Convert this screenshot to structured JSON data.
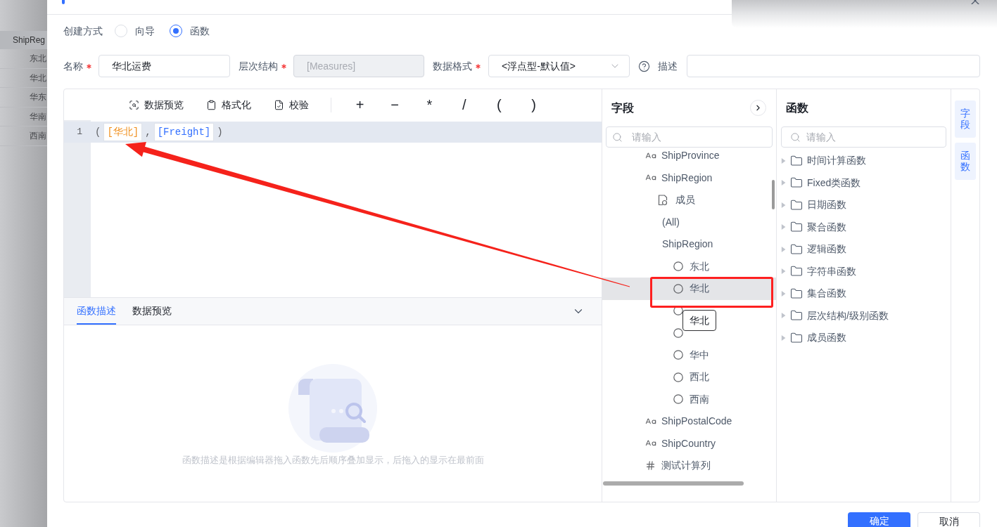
{
  "backdrop_table": {
    "header": "ShipReg",
    "rows": [
      "东北",
      "华北",
      "华东",
      "华南",
      "西南"
    ]
  },
  "creation_mode": {
    "label": "创建方式",
    "options": [
      {
        "label": "向导",
        "selected": false
      },
      {
        "label": "函数",
        "selected": true
      }
    ]
  },
  "form_fields": [
    {
      "kind": "input",
      "label": "名称",
      "required": true,
      "value": "华北运费",
      "disabled": false
    },
    {
      "kind": "input",
      "label": "层次结构",
      "required": true,
      "value": "[Measures]",
      "disabled": true
    },
    {
      "kind": "select",
      "label": "数据格式",
      "required": true,
      "value": "<浮点型-默认值>",
      "disabled": false
    },
    {
      "kind": "help_input",
      "label": "描述",
      "required": false,
      "disabled": false
    }
  ],
  "editor": {
    "toolbar": [
      {
        "kind": "preview",
        "label": "数据预览"
      },
      {
        "kind": "format",
        "label": "格式化"
      },
      {
        "kind": "validate",
        "label": "校验"
      }
    ],
    "operators": [
      "+",
      "−",
      "*",
      "/",
      "(",
      ")"
    ],
    "lines": [
      {
        "number": "1",
        "active": true,
        "tokens": [
          {
            "kind": "punct",
            "text": "("
          },
          {
            "kind": "member",
            "text": "[华北]"
          },
          {
            "kind": "punct",
            "text": ","
          },
          {
            "kind": "measure",
            "text": "[Freight]"
          },
          {
            "kind": "punct",
            "text": ")"
          }
        ]
      }
    ]
  },
  "bottom_panel": {
    "tabs": [
      {
        "label": "函数描述",
        "selected": true
      },
      {
        "label": "数据预览",
        "selected": false
      }
    ],
    "empty_text": "函数描述是根据编辑器拖入函数先后顺序叠加显示，后拖入的显示在最前面"
  },
  "fields_panel": {
    "title": "字段",
    "search_placeholder": "请输入",
    "tree": [
      {
        "kind": "text",
        "label": "ShipProvince"
      },
      {
        "kind": "text",
        "label": "ShipRegion",
        "children": [
          {
            "kind": "group",
            "label": "成员",
            "children": [
              {
                "kind": "level",
                "label": "(All)"
              },
              {
                "kind": "level",
                "label": "ShipRegion",
                "children": [
                  {
                    "kind": "member",
                    "label": "东北",
                    "hovered": false
                  },
                  {
                    "kind": "member",
                    "label": "华北",
                    "hovered": true
                  },
                  {
                    "kind": "member",
                    "hovered": false
                  },
                  {
                    "kind": "member",
                    "hovered": false
                  },
                  {
                    "kind": "member",
                    "label": "华中",
                    "hovered": false
                  },
                  {
                    "kind": "member",
                    "label": "西北",
                    "hovered": false
                  },
                  {
                    "kind": "member",
                    "label": "西南",
                    "hovered": false
                  }
                ]
              }
            ]
          }
        ]
      },
      {
        "kind": "text",
        "label": "ShipPostalCode"
      },
      {
        "kind": "text",
        "label": "ShipCountry"
      },
      {
        "kind": "number",
        "label": "测试计算列"
      }
    ],
    "tooltip": "华北"
  },
  "functions_panel": {
    "title": "函数",
    "search_placeholder": "请输入",
    "categories": [
      {
        "label": "时间计算函数",
        "expanded": false
      },
      {
        "label": "Fixed类函数",
        "expanded": false
      },
      {
        "label": "日期函数",
        "expanded": false
      },
      {
        "label": "聚合函数",
        "expanded": false
      },
      {
        "label": "逻辑函数",
        "expanded": false
      },
      {
        "label": "字符串函数",
        "expanded": false
      },
      {
        "label": "集合函数",
        "expanded": false
      },
      {
        "label": "层次结构/级别函数",
        "expanded": false
      },
      {
        "label": "成员函数",
        "expanded": false
      }
    ]
  },
  "side_tabs": [
    {
      "label": "字段",
      "on": true
    },
    {
      "label": "函数",
      "on": true
    }
  ],
  "footer_buttons": [
    {
      "kind": "primary",
      "label": "确定"
    },
    {
      "kind": "secondary",
      "label": "取消"
    }
  ],
  "annotations": [
    {
      "kind": "arrow"
    },
    {
      "kind": "box"
    }
  ]
}
